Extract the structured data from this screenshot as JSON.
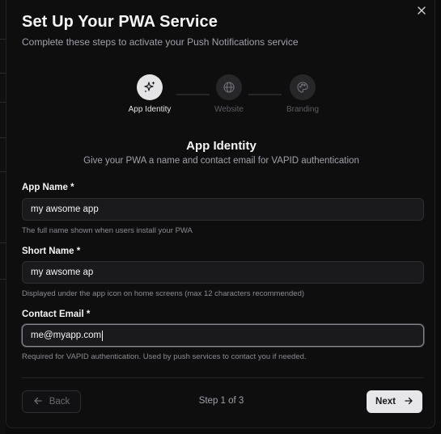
{
  "dialog": {
    "title": "Set Up Your PWA Service",
    "subtitle": "Complete these steps to activate your Push Notifications service",
    "close_icon": "close-icon"
  },
  "stepper": {
    "steps": [
      {
        "label": "App Identity",
        "icon": "sparkles-icon",
        "state": "active"
      },
      {
        "label": "Website",
        "icon": "globe-icon",
        "state": "inactive"
      },
      {
        "label": "Branding",
        "icon": "palette-icon",
        "state": "inactive"
      }
    ]
  },
  "section": {
    "title": "App Identity",
    "subtitle": "Give your PWA a name and contact email for VAPID authentication"
  },
  "fields": {
    "app_name": {
      "label": "App Name *",
      "value": "my awsome app",
      "help": "The full name shown when users install your PWA"
    },
    "short_name": {
      "label": "Short Name *",
      "value": "my awsome ap",
      "help": "Displayed under the app icon on home screens (max 12 characters recommended)"
    },
    "contact_email": {
      "label": "Contact Email *",
      "value": "me@myapp.com",
      "help": "Required for VAPID authentication. Used by push services to contact you if needed."
    }
  },
  "footer": {
    "back_label": "Back",
    "step_counter": "Step 1 of 3",
    "next_label": "Next"
  },
  "colors": {
    "background": "#0e0e0f",
    "primary_button": "#e7e7ea",
    "active_step": "#e4e4e7",
    "inactive_step": "#27272a"
  }
}
